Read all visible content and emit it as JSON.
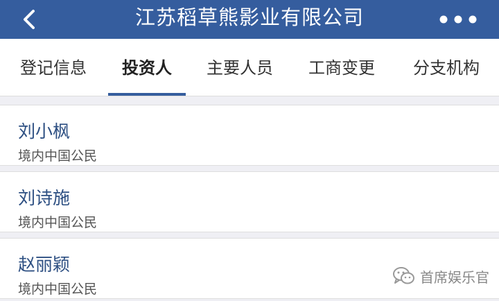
{
  "header": {
    "title": "江苏稻草熊影业有限公司",
    "back_icon": "chevron-left-icon",
    "more_icon": "ellipsis-icon",
    "color": "#355d9e"
  },
  "tabs": [
    {
      "label": "登记信息",
      "active": false
    },
    {
      "label": "投资人",
      "active": true
    },
    {
      "label": "主要人员",
      "active": false
    },
    {
      "label": "工商变更",
      "active": false
    },
    {
      "label": "分支机构",
      "active": false
    }
  ],
  "investors": [
    {
      "name": "刘小枫",
      "type": "境内中国公民"
    },
    {
      "name": "刘诗施",
      "type": "境内中国公民"
    },
    {
      "name": "赵丽颖",
      "type": "境内中国公民"
    }
  ],
  "watermark": {
    "text": "首席娱乐官",
    "icon": "wechat-icon"
  }
}
